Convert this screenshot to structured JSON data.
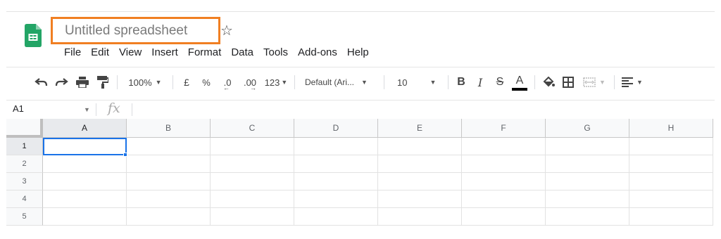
{
  "document": {
    "title": "Untitled spreadsheet",
    "star_icon": "star-outline-icon",
    "app_icon": "google-sheets-icon",
    "highlight_color": "#f07f22"
  },
  "menu": [
    "File",
    "Edit",
    "View",
    "Insert",
    "Format",
    "Data",
    "Tools",
    "Add-ons",
    "Help"
  ],
  "toolbar": {
    "zoom": "100%",
    "currency": "£",
    "percent": "%",
    "decrease_decimal": ".0",
    "increase_decimal": ".00",
    "more_formats": "123",
    "font": "Default (Ari...",
    "font_size": "10",
    "bold": "B",
    "italic": "I",
    "strike": "S",
    "text_color": "A",
    "icons": [
      "undo-icon",
      "redo-icon",
      "print-icon",
      "paint-format-icon",
      "fill-color-icon",
      "borders-icon",
      "merge-cells-icon",
      "align-icon"
    ]
  },
  "formula_bar": {
    "name_box": "A1",
    "fx": "fx",
    "value": ""
  },
  "grid": {
    "columns": [
      "A",
      "B",
      "C",
      "D",
      "E",
      "F",
      "G",
      "H"
    ],
    "rows": [
      "1",
      "2",
      "3",
      "4",
      "5"
    ],
    "selected_cell": "A1",
    "selection_color": "#1a73e8"
  }
}
